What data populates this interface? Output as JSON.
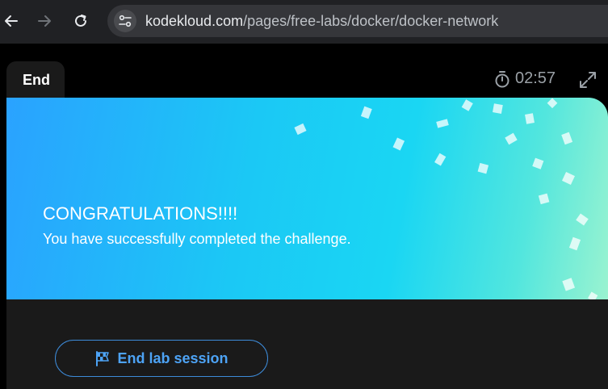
{
  "browser": {
    "url_host": "kodekloud.com",
    "url_path": "/pages/free-labs/docker/docker-network",
    "back_icon": "arrow-left-icon",
    "forward_icon": "arrow-right-icon",
    "reload_icon": "reload-icon",
    "site_info_icon": "tune-icon"
  },
  "lab": {
    "tab_label": "End",
    "timer": "02:57",
    "timer_icon": "stopwatch-icon",
    "expand_icon": "expand-icon"
  },
  "banner": {
    "title": "CONGRATULATIONS!!!!",
    "subtitle": "You have successfully completed the challenge."
  },
  "actions": {
    "end_label": "End lab session",
    "end_icon": "checkered-flag-icon"
  },
  "colors": {
    "accent": "#4da3f5",
    "banner_start": "#2aa2ff",
    "banner_end": "#9af3d0"
  }
}
